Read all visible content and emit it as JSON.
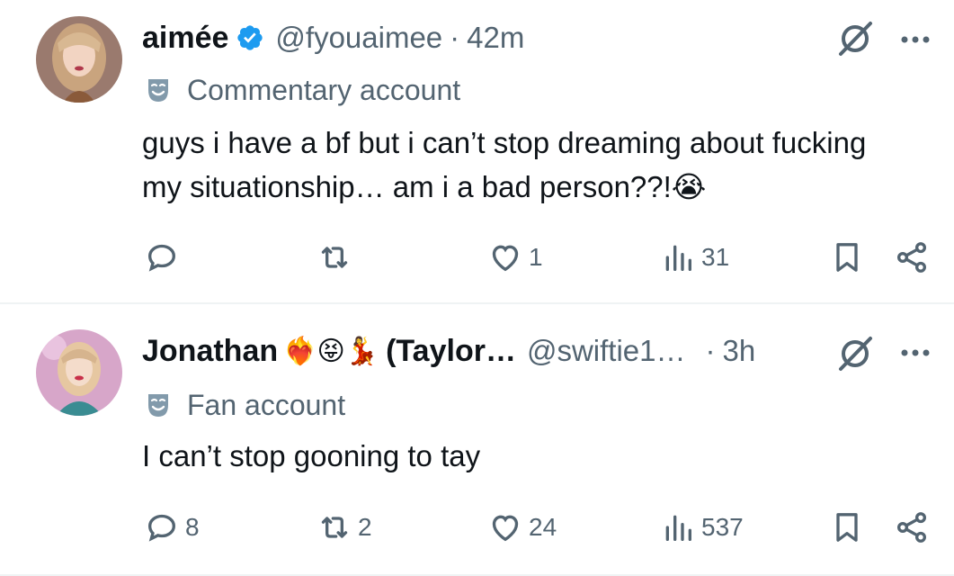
{
  "tweets": [
    {
      "display_name": "aimée",
      "name_suffix": "",
      "emojis": "",
      "verified": true,
      "handle": "@fyouaimee",
      "separator": "·",
      "time": "42m",
      "label": "Commentary account",
      "text": "guys i have a bf but i can’t stop dreaming about fucking my situationship… am i a bad person??!😭",
      "replies": "",
      "reposts": "",
      "likes": "1",
      "views": "31"
    },
    {
      "display_name": "Jonathan",
      "name_suffix": "(Taylor…",
      "emojis": "❤️‍🔥😝💃",
      "verified": false,
      "handle": "@swiftie1…",
      "separator": "·",
      "time": "3h",
      "label": "Fan account",
      "text": "I can’t stop gooning to tay",
      "replies": "8",
      "reposts": "2",
      "likes": "24",
      "views": "537"
    }
  ],
  "icons": {
    "grok": "grok-slash-icon",
    "more": "more-dots-icon",
    "label": "comedy-mask-icon",
    "reply": "reply-bubble-icon",
    "repost": "repost-arrows-icon",
    "like": "heart-icon",
    "views": "views-bars-icon",
    "bookmark": "bookmark-icon",
    "share": "share-icon"
  },
  "colors": {
    "text": "#0f1419",
    "secondary": "#536471",
    "verified": "#1d9bf0",
    "divider": "#eff3f4"
  }
}
